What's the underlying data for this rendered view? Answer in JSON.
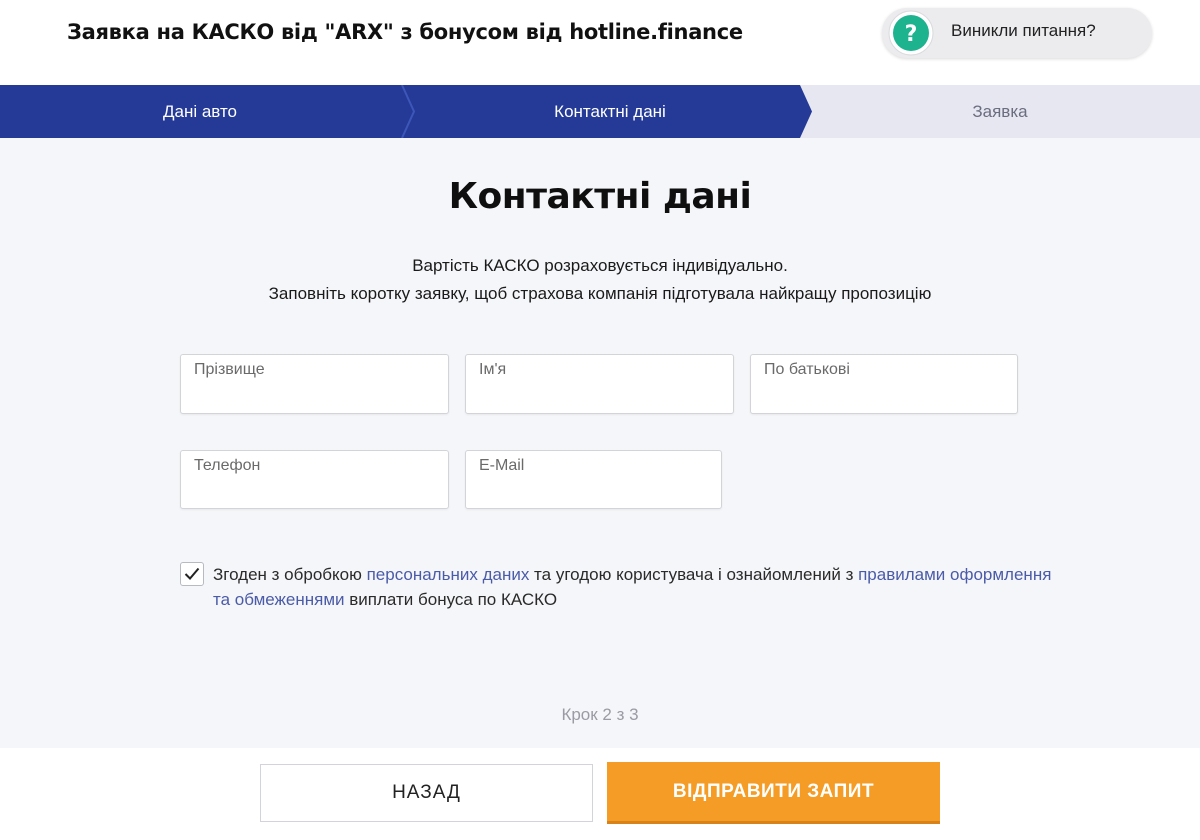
{
  "header": {
    "title": "Заявка на КАСКО від \"ARX\" з бонусом від hotline.finance",
    "help_label": "Виникли питання?"
  },
  "steps": [
    {
      "label": "Дані авто",
      "state": "done"
    },
    {
      "label": "Контактні дані",
      "state": "active"
    },
    {
      "label": "Заявка",
      "state": "pending"
    }
  ],
  "main": {
    "title": "Контактні дані",
    "subtitle_line1": "Вартість КАСКО розраховується індивідуально.",
    "subtitle_line2": "Заповніть коротку заявку, щоб страхова компанія підготувала найкращу пропозицію"
  },
  "form": {
    "surname": {
      "label": "Прізвище",
      "value": ""
    },
    "name": {
      "label": "Ім'я",
      "value": ""
    },
    "patronymic": {
      "label": "По батькові",
      "value": ""
    },
    "phone": {
      "label": "Телефон",
      "value": ""
    },
    "email": {
      "label": "E-Mail",
      "value": ""
    }
  },
  "consent": {
    "checked": true,
    "text_1": "Згоден з обробкою ",
    "link_1": "персональних даних",
    "text_2": " та угодою користувача і ознайомлений з ",
    "link_2": "правилами оформлення та обмеженнями",
    "text_3": " виплати бонуса по КАСКО"
  },
  "step_counter": "Крок 2 з 3",
  "footer": {
    "back_label": "НАЗАД",
    "submit_label": "ВІДПРАВИТИ ЗАПИТ"
  },
  "colors": {
    "step_active": "#243a96",
    "step_pending": "#e6e7f0",
    "accent_orange": "#f49c25",
    "help_icon": "#1db38f",
    "link": "#4a5ba8"
  }
}
